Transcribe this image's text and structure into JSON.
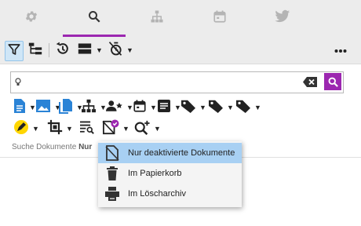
{
  "tabs": [
    {
      "icon": "gear-icon"
    },
    {
      "icon": "search-icon",
      "active": true
    },
    {
      "icon": "hierarchy-icon"
    },
    {
      "icon": "calendar-icon"
    },
    {
      "icon": "twitter-icon"
    }
  ],
  "search": {
    "value": "",
    "placeholder": ""
  },
  "status": {
    "prefix": "Suche Dokumente",
    "bold": "Nur"
  },
  "menu": {
    "items": [
      {
        "label": "Nur deaktivierte Dokumente",
        "icon": "deactivated-document-icon",
        "selected": true
      },
      {
        "label": "Im Papierkorb",
        "icon": "trash-icon"
      },
      {
        "label": "Im Löscharchiv",
        "icon": "archive-icon"
      }
    ]
  },
  "colors": {
    "accent": "#9c27b0",
    "primary": "#2a83d6",
    "menu_selected": "#a8d0f3",
    "highlighter": "#ffd600"
  }
}
